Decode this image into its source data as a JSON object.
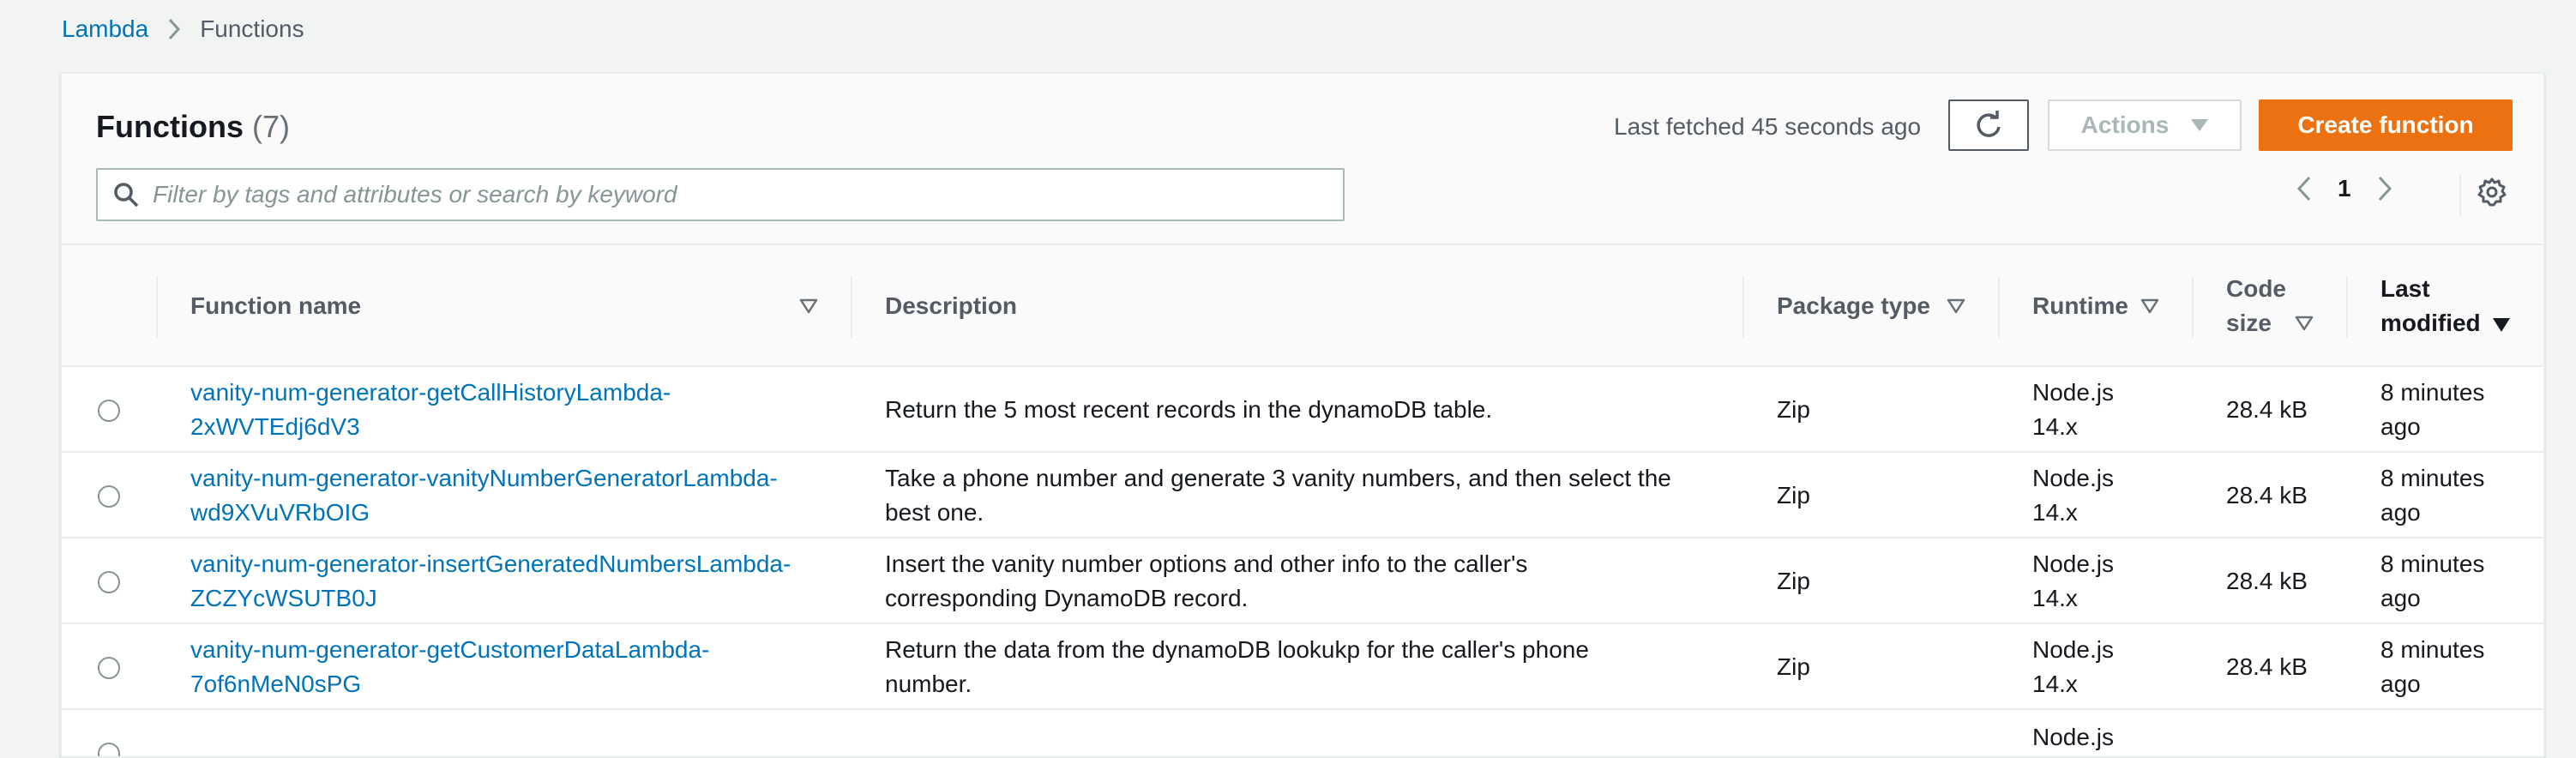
{
  "breadcrumb": {
    "root": "Lambda",
    "current": "Functions"
  },
  "header": {
    "title": "Functions",
    "count": "(7)",
    "last_fetched": "Last fetched 45 seconds ago",
    "actions_label": "Actions",
    "create_label": "Create function",
    "search_placeholder": "Filter by tags and attributes or search by keyword",
    "page_number": "1"
  },
  "columns": {
    "name": "Function name",
    "description": "Description",
    "package_type": "Package type",
    "runtime": "Runtime",
    "code_size_1": "Code",
    "code_size_2": "size",
    "last_modified_1": "Last",
    "last_modified_2": "modified"
  },
  "rows": [
    {
      "name_1": "vanity-num-generator-getCallHistoryLambda-",
      "name_2": "2xWVTEdj6dV3",
      "desc_1": "Return the 5 most recent records in the dynamoDB table.",
      "desc_2": "",
      "package_type": "Zip",
      "runtime_1": "Node.js",
      "runtime_2": "14.x",
      "code_size": "28.4 kB",
      "modified_1": "8 minutes",
      "modified_2": "ago"
    },
    {
      "name_1": "vanity-num-generator-vanityNumberGeneratorLambda-",
      "name_2": "wd9XVuVRbOIG",
      "desc_1": "Take a phone number and generate 3 vanity numbers, and then select the",
      "desc_2": "best one.",
      "package_type": "Zip",
      "runtime_1": "Node.js",
      "runtime_2": "14.x",
      "code_size": "28.4 kB",
      "modified_1": "8 minutes",
      "modified_2": "ago"
    },
    {
      "name_1": "vanity-num-generator-insertGeneratedNumbersLambda-",
      "name_2": "ZCZYcWSUTB0J",
      "desc_1": "Insert the vanity number options and other info to the caller's",
      "desc_2": "corresponding DynamoDB record.",
      "package_type": "Zip",
      "runtime_1": "Node.js",
      "runtime_2": "14.x",
      "code_size": "28.4 kB",
      "modified_1": "8 minutes",
      "modified_2": "ago"
    },
    {
      "name_1": "vanity-num-generator-getCustomerDataLambda-",
      "name_2": "7of6nMeN0sPG",
      "desc_1": "Return the data from the dynamoDB lookukp for the caller's phone",
      "desc_2": "number.",
      "package_type": "Zip",
      "runtime_1": "Node.js",
      "runtime_2": "14.x",
      "code_size": "28.4 kB",
      "modified_1": "8 minutes",
      "modified_2": "ago"
    },
    {
      "name_1": "",
      "name_2": "",
      "desc_1": "",
      "desc_2": "",
      "package_type": "",
      "runtime_1": "Node.js",
      "runtime_2": "",
      "code_size": "",
      "modified_1": "",
      "modified_2": ""
    }
  ],
  "colors": {
    "link": "#0073bb",
    "primary_button": "#ec7211",
    "border": "#eaeded",
    "muted_text": "#545b64"
  }
}
